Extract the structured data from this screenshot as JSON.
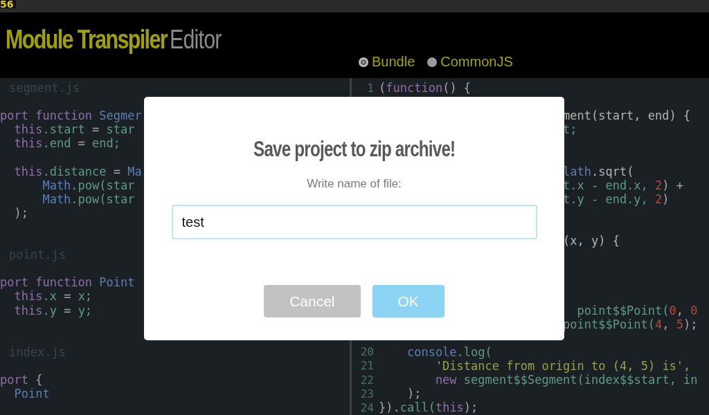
{
  "badge": "56",
  "header": {
    "title_strong": "Module Transpiler",
    "title_light": "Editor",
    "modes": [
      {
        "label": "Bundle",
        "selected": true
      },
      {
        "label": "CommonJS",
        "selected": false
      }
    ]
  },
  "source_pane": {
    "rows": [
      {
        "kind": "file",
        "name": "segment.js"
      },
      {
        "kind": "blank"
      },
      {
        "kind": "code",
        "tokens": [
          {
            "kind": "kw",
            "text": "port function "
          },
          {
            "kind": "builtin",
            "text": "Segmer"
          }
        ]
      },
      {
        "kind": "code",
        "tokens": [
          {
            "kind": "kw",
            "text": "  this"
          },
          {
            "kind": "prop",
            "text": ".start"
          },
          {
            "kind": "punct",
            "text": " = "
          },
          {
            "kind": "prop",
            "text": "star"
          }
        ]
      },
      {
        "kind": "code",
        "tokens": [
          {
            "kind": "kw",
            "text": "  this"
          },
          {
            "kind": "prop",
            "text": ".end"
          },
          {
            "kind": "punct",
            "text": " = "
          },
          {
            "kind": "prop",
            "text": "end;"
          }
        ]
      },
      {
        "kind": "blank"
      },
      {
        "kind": "code",
        "tokens": [
          {
            "kind": "kw",
            "text": "  this"
          },
          {
            "kind": "prop",
            "text": ".distance"
          },
          {
            "kind": "punct",
            "text": " = "
          },
          {
            "kind": "builtin",
            "text": "Ma"
          }
        ]
      },
      {
        "kind": "code",
        "tokens": [
          {
            "kind": "builtin",
            "text": "      Math"
          },
          {
            "kind": "prop",
            "text": ".pow(star"
          }
        ]
      },
      {
        "kind": "code",
        "tokens": [
          {
            "kind": "builtin",
            "text": "      Math"
          },
          {
            "kind": "prop",
            "text": ".pow(star"
          }
        ]
      },
      {
        "kind": "code",
        "tokens": [
          {
            "kind": "punct",
            "text": "  );"
          }
        ]
      },
      {
        "kind": "blank"
      },
      {
        "kind": "blank"
      },
      {
        "kind": "file",
        "name": "point.js"
      },
      {
        "kind": "blank"
      },
      {
        "kind": "code",
        "tokens": [
          {
            "kind": "kw",
            "text": "port function "
          },
          {
            "kind": "builtin",
            "text": "Point"
          }
        ]
      },
      {
        "kind": "code",
        "tokens": [
          {
            "kind": "kw",
            "text": "  this"
          },
          {
            "kind": "prop",
            "text": ".x"
          },
          {
            "kind": "punct",
            "text": " = "
          },
          {
            "kind": "prop",
            "text": "x;"
          }
        ]
      },
      {
        "kind": "code",
        "tokens": [
          {
            "kind": "kw",
            "text": "  this"
          },
          {
            "kind": "prop",
            "text": ".y"
          },
          {
            "kind": "punct",
            "text": " = "
          },
          {
            "kind": "prop",
            "text": "y;"
          }
        ]
      },
      {
        "kind": "blank"
      },
      {
        "kind": "blank"
      },
      {
        "kind": "file",
        "name": "index.js"
      },
      {
        "kind": "blank"
      },
      {
        "kind": "code",
        "tokens": [
          {
            "kind": "kw",
            "text": "port"
          },
          {
            "kind": "punct",
            "text": " {"
          }
        ]
      },
      {
        "kind": "code",
        "tokens": [
          {
            "kind": "builtin",
            "text": "  Point"
          }
        ]
      }
    ]
  },
  "output_pane": {
    "rows": [
      {
        "kind": "code",
        "number": "1",
        "tokens": [
          {
            "kind": "punct",
            "text": "("
          },
          {
            "kind": "kw",
            "text": "function"
          },
          {
            "kind": "punct",
            "text": "() {"
          }
        ]
      },
      {
        "kind": "blank"
      },
      {
        "kind": "behind",
        "tokens": [
          {
            "kind": "plain",
            "text": "ment(start, end) {"
          }
        ]
      },
      {
        "kind": "behind",
        "tokens": [
          {
            "kind": "prop",
            "text": "t;"
          }
        ]
      },
      {
        "kind": "blank"
      },
      {
        "kind": "blank"
      },
      {
        "kind": "behind",
        "tokens": [
          {
            "kind": "builtin",
            "text": "lath"
          },
          {
            "kind": "plain",
            "text": ".sqrt("
          }
        ]
      },
      {
        "kind": "behind",
        "tokens": [
          {
            "kind": "prop",
            "text": "t.x - end.x, "
          },
          {
            "kind": "num",
            "text": "2"
          },
          {
            "kind": "punct",
            "text": ") +"
          }
        ]
      },
      {
        "kind": "behind",
        "tokens": [
          {
            "kind": "prop",
            "text": "t.y - end.y, "
          },
          {
            "kind": "num",
            "text": "2"
          },
          {
            "kind": "punct",
            "text": ")"
          }
        ]
      },
      {
        "kind": "blank"
      },
      {
        "kind": "blank"
      },
      {
        "kind": "behind",
        "tokens": [
          {
            "kind": "plain",
            "text": "(x, y) {"
          }
        ]
      },
      {
        "kind": "blank"
      },
      {
        "kind": "blank"
      },
      {
        "kind": "blank"
      },
      {
        "kind": "blank"
      },
      {
        "kind": "behind",
        "tokens": [
          {
            "kind": "prop",
            "text": "  point$$Point("
          },
          {
            "kind": "num",
            "text": "0"
          },
          {
            "kind": "punct",
            "text": ", "
          },
          {
            "kind": "num",
            "text": "0"
          }
        ]
      },
      {
        "kind": "behind",
        "tokens": [
          {
            "kind": "prop",
            "text": "point$$Point("
          },
          {
            "kind": "num",
            "text": "4"
          },
          {
            "kind": "punct",
            "text": ", "
          },
          {
            "kind": "num",
            "text": "5"
          },
          {
            "kind": "punct",
            "text": ");"
          }
        ]
      },
      {
        "kind": "blank"
      },
      {
        "kind": "code",
        "number": "20",
        "tokens": [
          {
            "kind": "builtin",
            "text": "    console"
          },
          {
            "kind": "prop",
            "text": ".log("
          }
        ]
      },
      {
        "kind": "code",
        "number": "21",
        "tokens": [
          {
            "kind": "str",
            "text": "        'Distance from origin to (4, 5) is',"
          }
        ]
      },
      {
        "kind": "code",
        "number": "22",
        "tokens": [
          {
            "kind": "kw",
            "text": "        new"
          },
          {
            "kind": "prop",
            "text": " segment$$Segment(index$$start, in"
          }
        ]
      },
      {
        "kind": "code",
        "number": "23",
        "tokens": [
          {
            "kind": "punct",
            "text": "    );"
          }
        ]
      },
      {
        "kind": "code",
        "number": "24",
        "tokens": [
          {
            "kind": "punct",
            "text": "})."
          },
          {
            "kind": "prop",
            "text": "call("
          },
          {
            "kind": "kw",
            "text": "this"
          },
          {
            "kind": "punct",
            "text": ");"
          }
        ]
      }
    ]
  },
  "dialog": {
    "title": "Save project to zip archive!",
    "prompt": "Write name of file:",
    "value": "test",
    "buttons": [
      {
        "kind": "cancel",
        "label": "Cancel"
      },
      {
        "kind": "ok",
        "label": "OK"
      }
    ]
  }
}
